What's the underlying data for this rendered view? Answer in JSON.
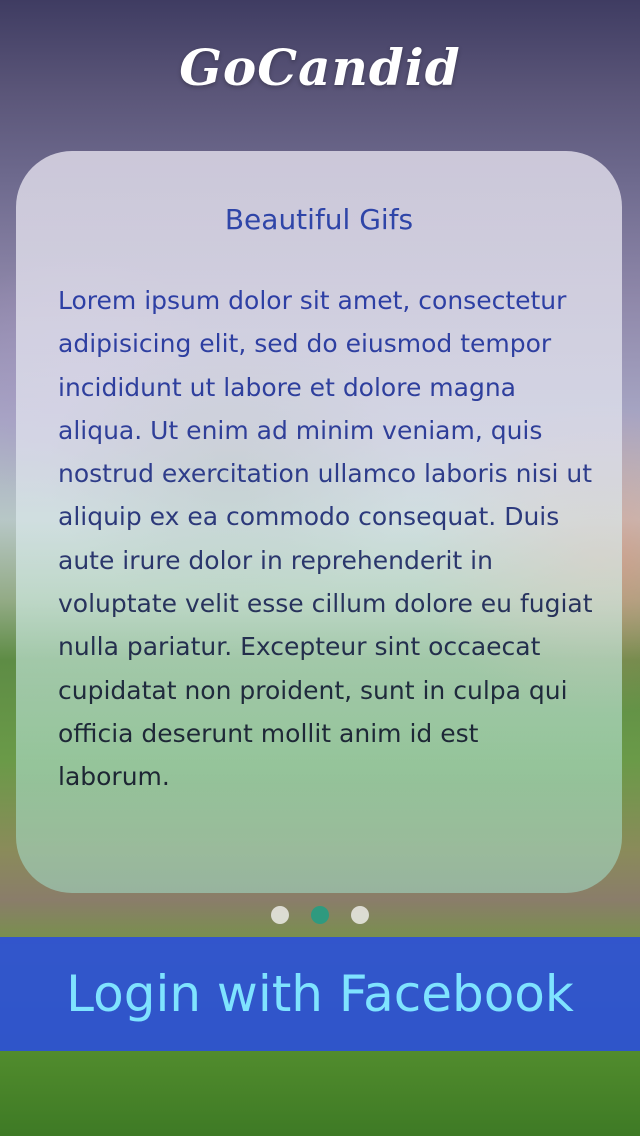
{
  "app": {
    "brand": "GoCandid"
  },
  "card": {
    "title": "Beautiful Gifs",
    "body": "Lorem ipsum dolor sit amet, consectetur adipisicing elit, sed do eiusmod tempor incididunt ut labore et dolore magna aliqua. Ut enim ad minim veniam, quis nostrud exercitation ullamco laboris nisi ut aliquip ex ea commodo consequat. Duis aute irure dolor in reprehenderit in voluptate velit esse cillum dolore eu fugiat nulla pariatur. Excepteur sint occaecat cupidatat non proident, sunt in culpa qui officia deserunt mollit anim id est laborum."
  },
  "pager": {
    "count": 3,
    "active_index": 1
  },
  "login": {
    "label": "Login with Facebook"
  },
  "colors": {
    "card_title": "#2f45a8",
    "login_bar": "#2d50d7",
    "login_text": "#7fe3ff",
    "dot_active": "#2f9a7f",
    "dot_inactive": "#ebebe6"
  }
}
